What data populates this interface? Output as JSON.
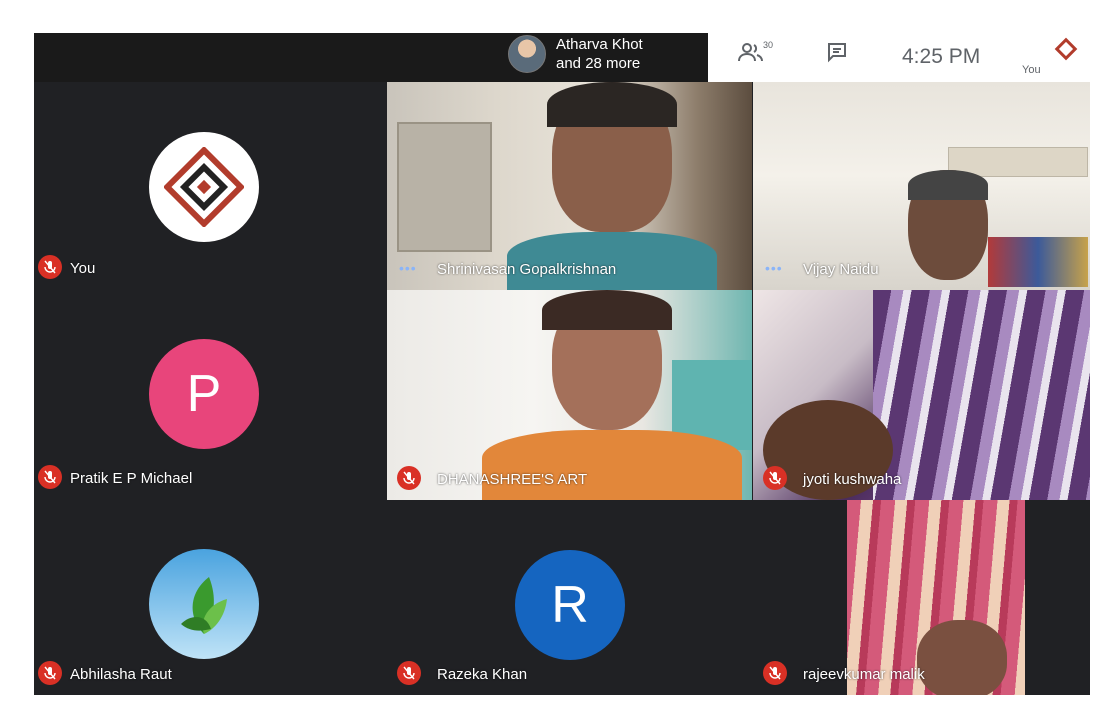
{
  "header": {
    "presenter_line1": "Atharva Khot",
    "presenter_line2": "and 28 more",
    "people_count": "30",
    "time": "4:25 PM",
    "you_label": "You"
  },
  "participants": [
    {
      "name": "You",
      "avatar_letter": "",
      "avatar_kind": "logo",
      "muted": true
    },
    {
      "name": "Pratik E P Michael",
      "avatar_letter": "P",
      "avatar_color": "#e8457b",
      "muted": true
    },
    {
      "name": "Abhilasha Raut",
      "avatar_kind": "leaf",
      "muted": true
    },
    {
      "name": "Shrinivasan Gopalkrishnan",
      "video": true,
      "speaking": true
    },
    {
      "name": "Vijay Naidu",
      "video": true,
      "speaking": true
    },
    {
      "name": "DHANASHREE'S ART",
      "video": true,
      "muted": true
    },
    {
      "name": "jyoti kushwaha",
      "video": true,
      "muted": true
    },
    {
      "name": "Razeka Khan",
      "avatar_letter": "R",
      "avatar_color": "#1565c0",
      "muted": true
    },
    {
      "name": "rajeevkumar malik",
      "video": true,
      "muted": true
    }
  ]
}
